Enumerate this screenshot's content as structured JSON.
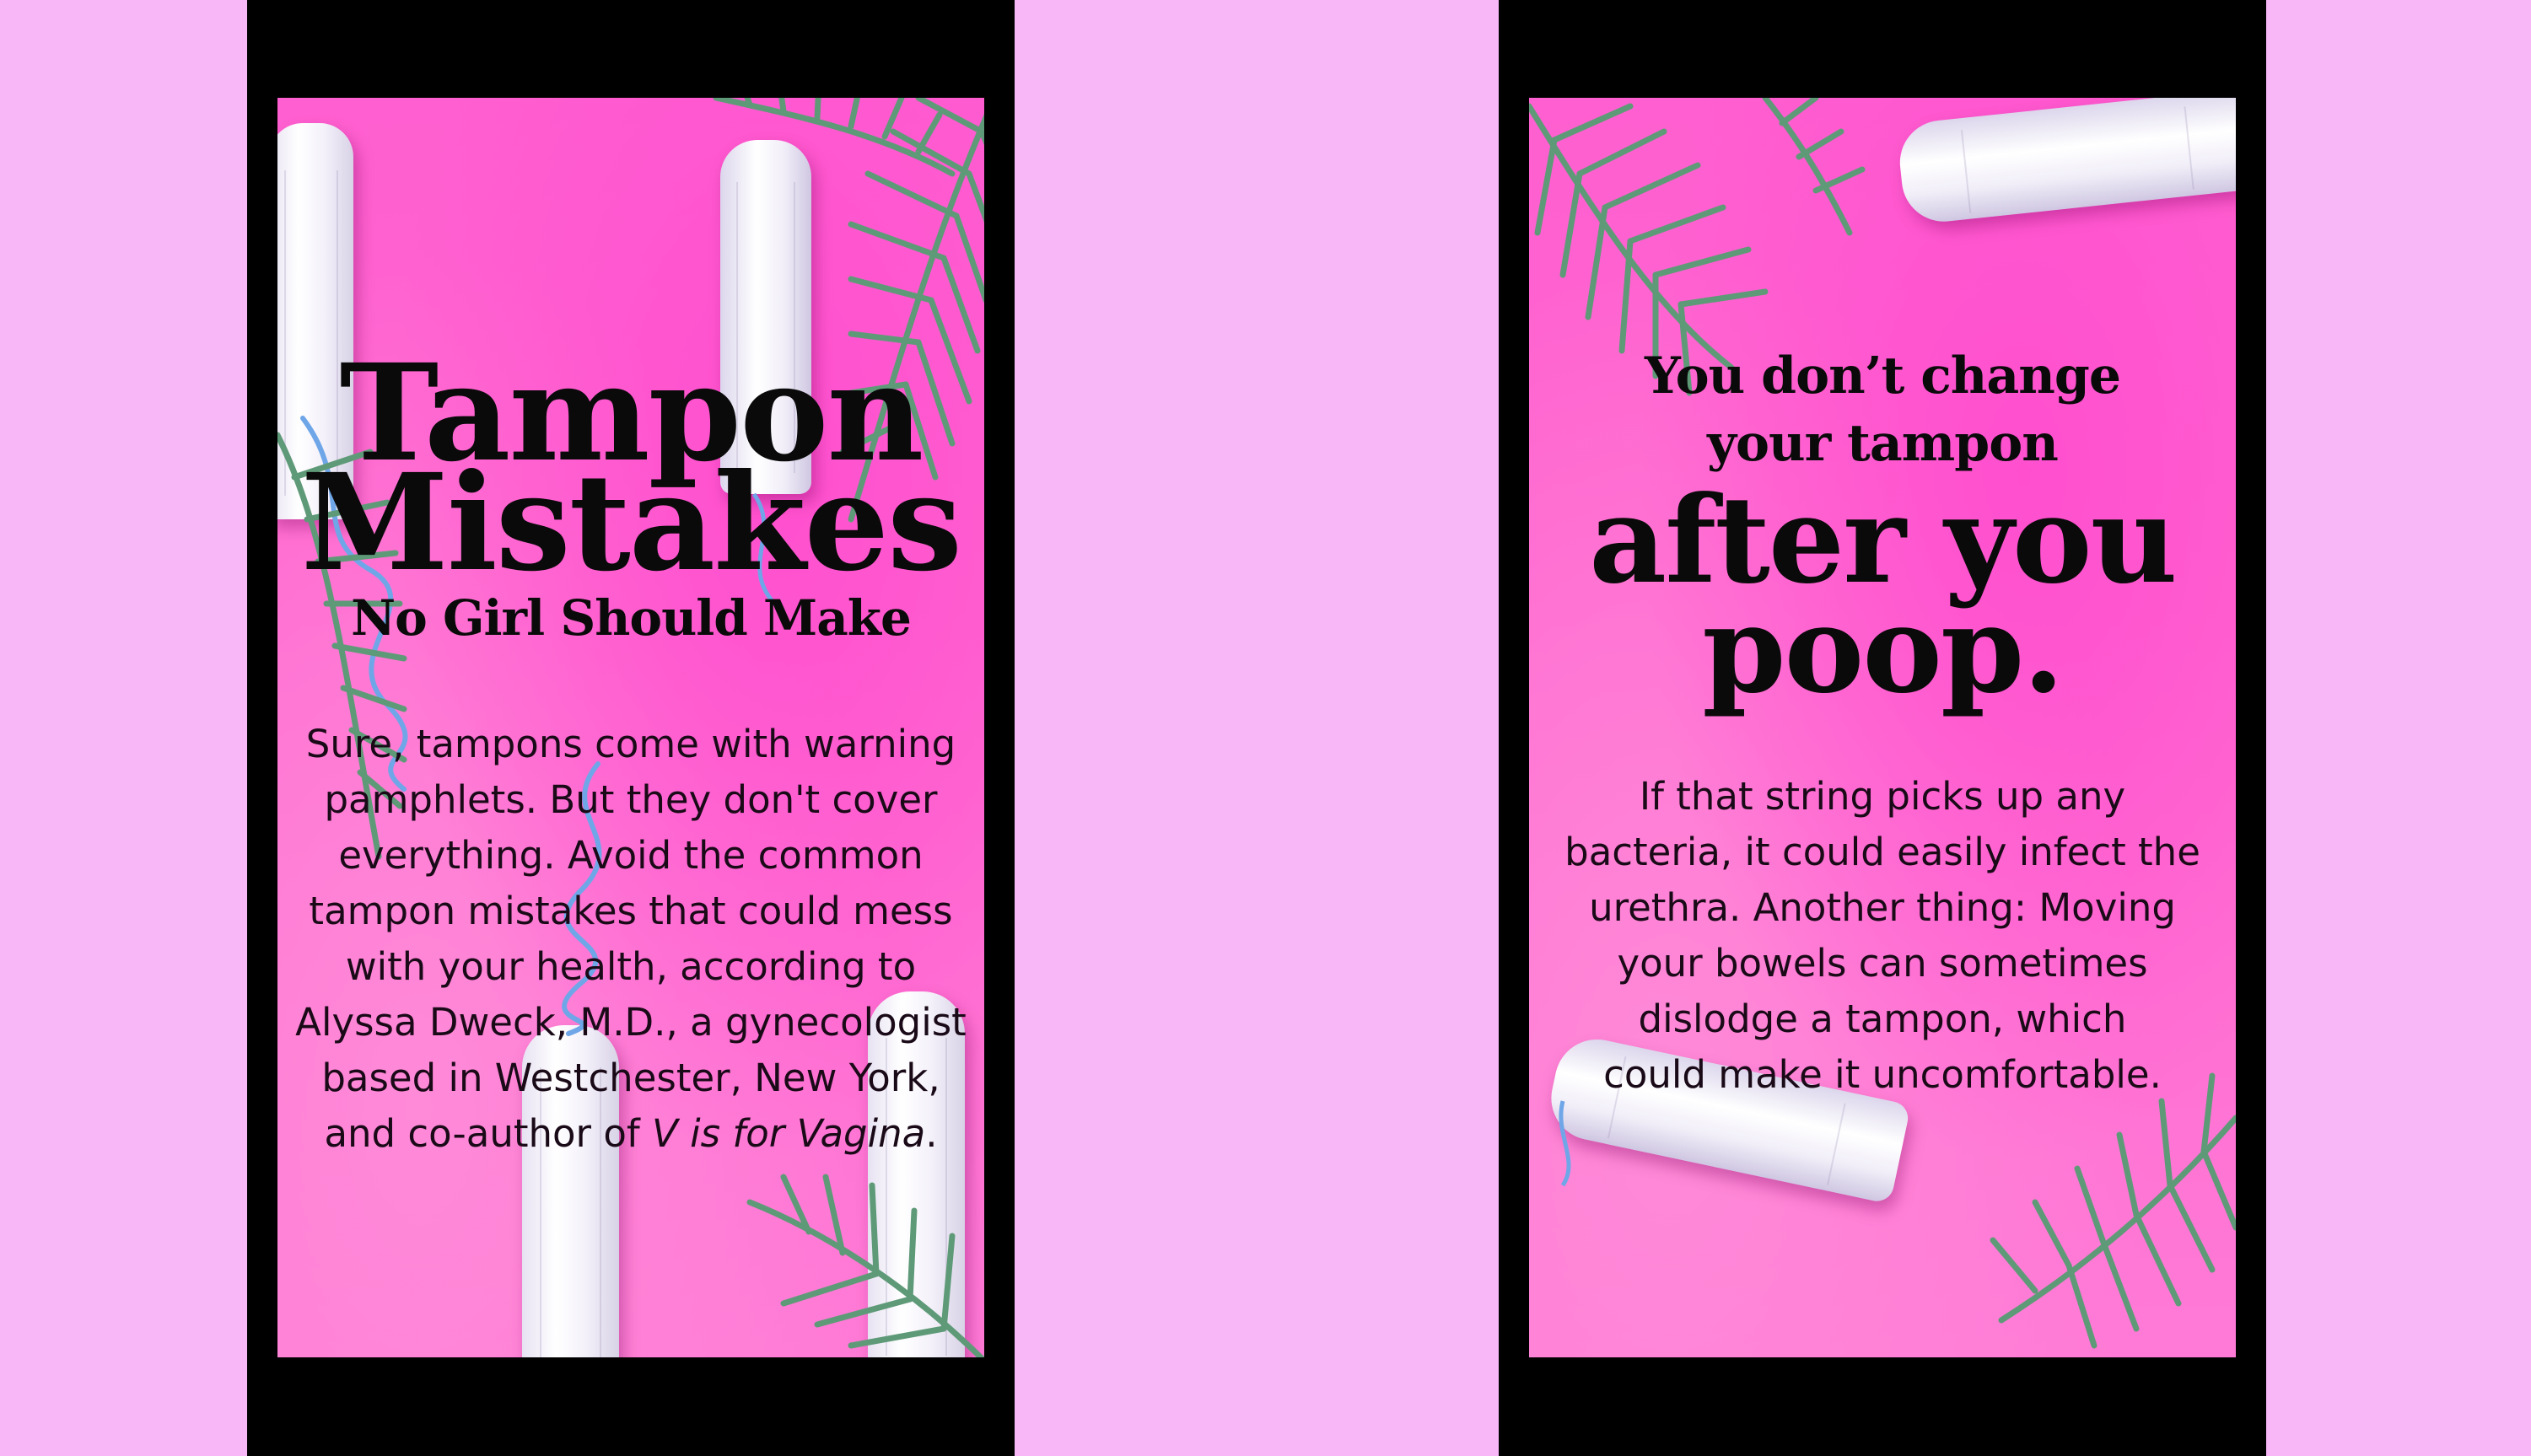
{
  "slides": [
    {
      "title_line1": "Tampon",
      "title_line2": "Mistakes",
      "subtitle": "No Girl Should Make",
      "body_lines": [
        "Sure, tampons come with warning",
        "pamphlets. But they don't cover",
        "everything. Avoid the common",
        "tampon mistakes that could mess",
        "with your health, according to",
        "Alyssa Dweck, M.D., a gynecologist",
        "based in Westchester, New York,"
      ],
      "body_last_prefix": "and co-author of ",
      "body_last_italic": "V is for Vagina",
      "body_last_suffix": "."
    },
    {
      "headline_small_line1": "You don’t change",
      "headline_small_line2": "your tampon",
      "headline_large_line1": "after you",
      "headline_large_line2": "poop.",
      "body_lines": [
        "If that string picks up any",
        "bacteria, it could easily infect the",
        "urethra. Another thing: Moving",
        "your bowels can sometimes",
        "dislodge a tampon, which",
        "could make it uncomfortable."
      ]
    }
  ],
  "colors": {
    "page_background": "#f8b8f8",
    "screen_pink": "#ff5fd0",
    "text": "#0a0a0a",
    "leaf_green": "#5f9a78",
    "string_blue": "#6fa6e8"
  },
  "icons": [
    "tampon-image",
    "palm-leaf-image",
    "tampon-string-image"
  ]
}
